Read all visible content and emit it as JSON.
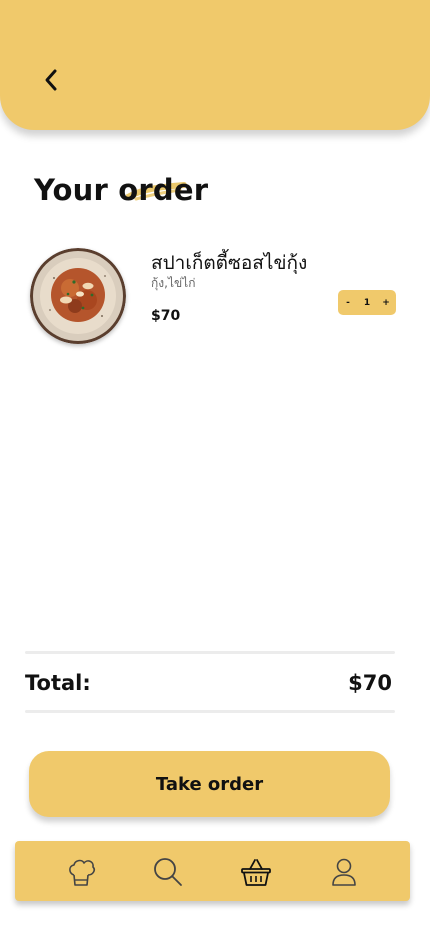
{
  "page": {
    "title": "Your order"
  },
  "order_item": {
    "name": "สปาเก็ตตี้ซอสไข่กุ้ง",
    "description": "กุ้ง,ไข่ไก่",
    "price": "$70",
    "quantity": "1",
    "decrement_label": "-",
    "increment_label": "+"
  },
  "summary": {
    "total_label": "Total:",
    "total_value": "$70"
  },
  "actions": {
    "take_order_label": "Take order"
  },
  "nav": {
    "items": [
      "chef-hat-icon",
      "search-icon",
      "basket-icon",
      "profile-icon"
    ],
    "active": "basket-icon"
  },
  "colors": {
    "accent": "#f0c96b",
    "text": "#111111"
  }
}
